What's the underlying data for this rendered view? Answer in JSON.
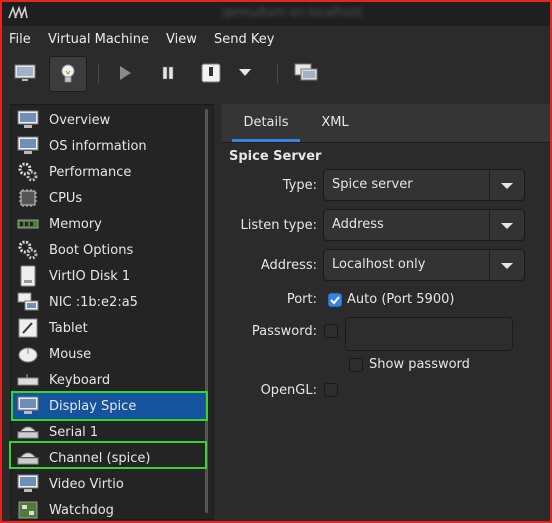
{
  "window": {
    "title": "qemu/kvm on localhost"
  },
  "menu": [
    "File",
    "Virtual Machine",
    "View",
    "Send Key"
  ],
  "toolbar": {
    "icons": [
      "monitor-icon",
      "lightbulb-icon",
      "play-icon",
      "pause-icon",
      "power-icon",
      "dropdown-arrow-icon",
      "screenshot-icon"
    ],
    "active": "lightbulb-icon"
  },
  "sidebar": {
    "items": [
      {
        "label": "Overview",
        "icon": "monitor-icon"
      },
      {
        "label": "OS information",
        "icon": "monitor-icon"
      },
      {
        "label": "Performance",
        "icon": "gears-icon"
      },
      {
        "label": "CPUs",
        "icon": "cpu-chip-icon"
      },
      {
        "label": "Memory",
        "icon": "memory-module-icon"
      },
      {
        "label": "Boot Options",
        "icon": "gears-icon"
      },
      {
        "label": "VirtIO Disk 1",
        "icon": "disk-icon"
      },
      {
        "label": "NIC :1b:e2:a5",
        "icon": "network-icon"
      },
      {
        "label": "Tablet",
        "icon": "tablet-icon"
      },
      {
        "label": "Mouse",
        "icon": "mouse-icon"
      },
      {
        "label": "Keyboard",
        "icon": "keyboard-icon"
      },
      {
        "label": "Display Spice",
        "icon": "monitor-icon"
      },
      {
        "label": "Serial 1",
        "icon": "serial-icon"
      },
      {
        "label": "Channel (spice)",
        "icon": "channel-icon"
      },
      {
        "label": "Video Virtio",
        "icon": "monitor-icon"
      },
      {
        "label": "Watchdog",
        "icon": "watchdog-icon"
      }
    ],
    "selected": "Display Spice",
    "highlighted": [
      "Display Spice",
      "Channel (spice)"
    ]
  },
  "tabs": [
    {
      "label": "Details",
      "active": true
    },
    {
      "label": "XML",
      "active": false
    }
  ],
  "details": {
    "section_title": "Spice Server",
    "type_label": "Type:",
    "type_value": "Spice server",
    "listen_label": "Listen type:",
    "listen_value": "Address",
    "address_label": "Address:",
    "address_value": "Localhost only",
    "port_label": "Port:",
    "port_auto_label": "Auto (Port 5900)",
    "port_auto_checked": true,
    "password_label": "Password:",
    "password_checked": false,
    "password_value": "",
    "show_password_label": "Show password",
    "show_password_checked": false,
    "opengl_label": "OpenGL:",
    "opengl_checked": false
  },
  "colors": {
    "selection": "#15539e",
    "highlight_box": "#33d633",
    "window_border": "#e3261f",
    "accent": "#3584e4"
  }
}
